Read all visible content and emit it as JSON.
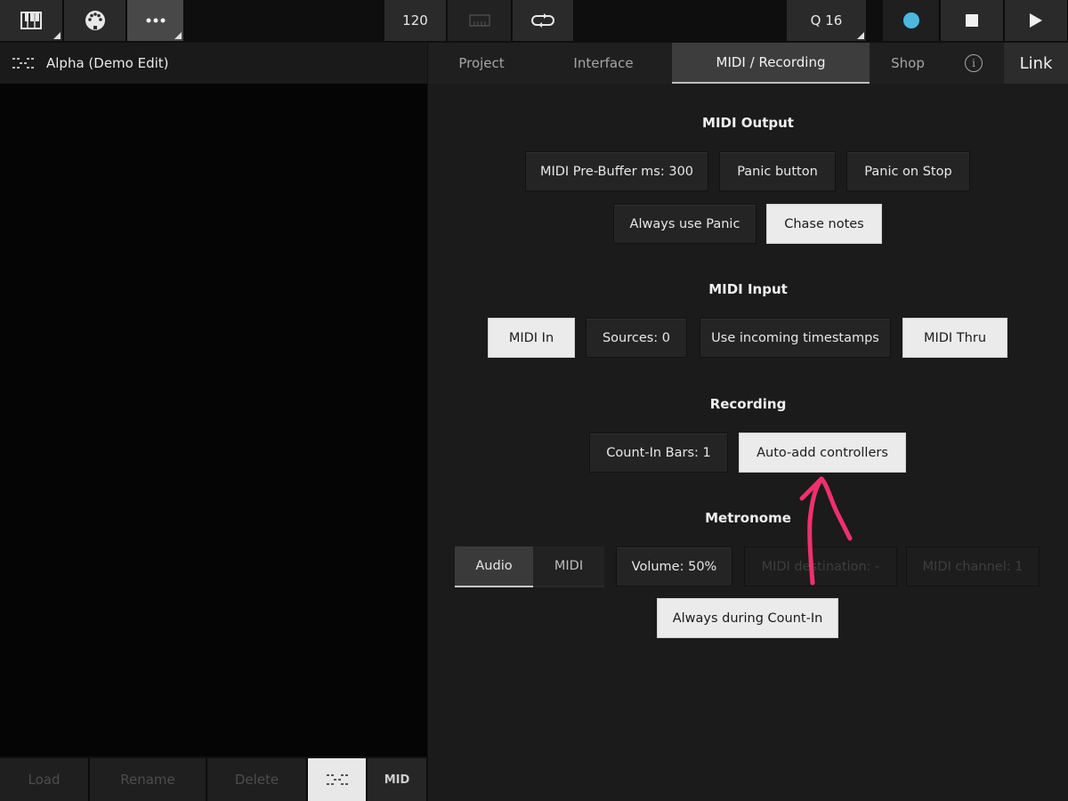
{
  "toolbar": {
    "tempo": "120",
    "quantize": "Q 16",
    "colors": {
      "record": "#4cb8e0"
    }
  },
  "project": {
    "title": "Alpha (Demo Edit)"
  },
  "file_actions": {
    "load": "Load",
    "rename": "Rename",
    "delete": "Delete",
    "mid": "MID"
  },
  "tabs": {
    "project": "Project",
    "interface": "Interface",
    "midi_recording": "MIDI / Recording",
    "shop": "Shop",
    "info": "i",
    "link": "Link"
  },
  "midi_output": {
    "title": "MIDI Output",
    "pre_buffer": "MIDI Pre-Buffer ms: 300",
    "panic_button": "Panic button",
    "panic_on_stop": "Panic on Stop",
    "always_use_panic": "Always use Panic",
    "chase_notes": "Chase notes"
  },
  "midi_input": {
    "title": "MIDI Input",
    "midi_in": "MIDI In",
    "sources": "Sources: 0",
    "use_timestamps": "Use incoming timestamps",
    "midi_thru": "MIDI Thru"
  },
  "recording": {
    "title": "Recording",
    "count_in": "Count-In Bars: 1",
    "auto_add": "Auto-add controllers"
  },
  "metronome": {
    "title": "Metronome",
    "audio": "Audio",
    "midi": "MIDI",
    "volume": "Volume: 50%",
    "midi_destination": "MIDI destination: -",
    "midi_channel": "MIDI channel: 1",
    "always_count_in": "Always during Count-In"
  },
  "annotation": {
    "color": "#f0306e"
  }
}
